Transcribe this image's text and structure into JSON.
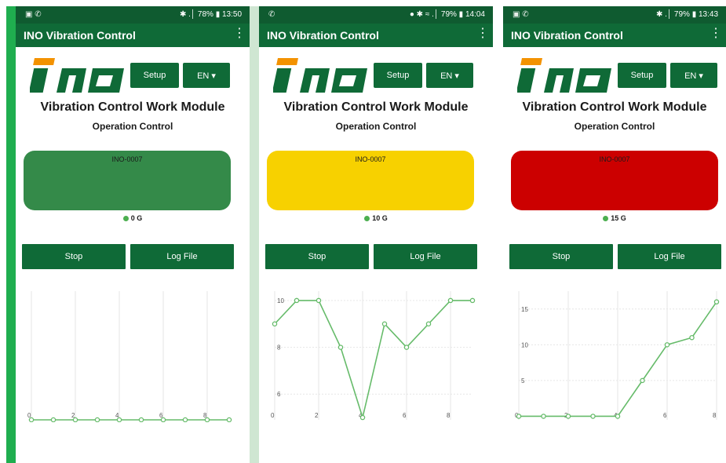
{
  "app_title": "INO Vibration Control",
  "setup_label": "Setup",
  "lang_label": "EN ▾",
  "main_title": "Vibration Control Work Module",
  "sub_title": "Operation Control",
  "stop_label": "Stop",
  "log_label": "Log File",
  "screens": [
    {
      "status_left": "▣ ✆",
      "status_right": "✱ .│ 78% ▮ 13:50",
      "device": "INO-0007",
      "level": "0 G",
      "status_color": "#348a49",
      "chart_data": {
        "type": "line",
        "x": [
          0,
          1,
          2,
          3,
          4,
          5,
          6,
          7,
          8,
          9
        ],
        "y": [
          0,
          0,
          0,
          0,
          0,
          0,
          0,
          0,
          0,
          0
        ],
        "x_ticks": [
          0,
          2,
          4,
          6,
          8
        ],
        "y_ticks": [],
        "ylim": [
          0,
          10
        ],
        "grid": true
      }
    },
    {
      "status_left": "✆",
      "status_right": "● ✱ ≈ .│ 79% ▮ 14:04",
      "device": "INO-0007",
      "level": "10 G",
      "status_color": "#f7d100",
      "chart_data": {
        "type": "line",
        "x": [
          0,
          1,
          2,
          3,
          4,
          5,
          6,
          7,
          8,
          9
        ],
        "y": [
          9,
          10,
          10,
          8,
          5,
          9,
          8,
          9,
          10,
          10
        ],
        "x_ticks": [
          0,
          2,
          4,
          6,
          8
        ],
        "y_ticks": [
          6,
          8,
          10
        ],
        "ylim": [
          4.9,
          10.4
        ],
        "grid": true
      }
    },
    {
      "status_left": "▣ ✆",
      "status_right": "✱ .│ 79% ▮ 13:43",
      "device": "INO-0007",
      "level": "15 G",
      "status_color": "#cc0000",
      "chart_data": {
        "type": "line",
        "x": [
          0,
          1,
          2,
          3,
          4,
          5,
          6,
          7,
          8
        ],
        "y": [
          0,
          0,
          0,
          0,
          0,
          5,
          10,
          11,
          16
        ],
        "x_ticks": [
          0,
          2,
          4,
          6,
          8
        ],
        "y_ticks": [
          5,
          10,
          15
        ],
        "ylim": [
          -0.5,
          17.5
        ],
        "grid": true
      }
    }
  ]
}
